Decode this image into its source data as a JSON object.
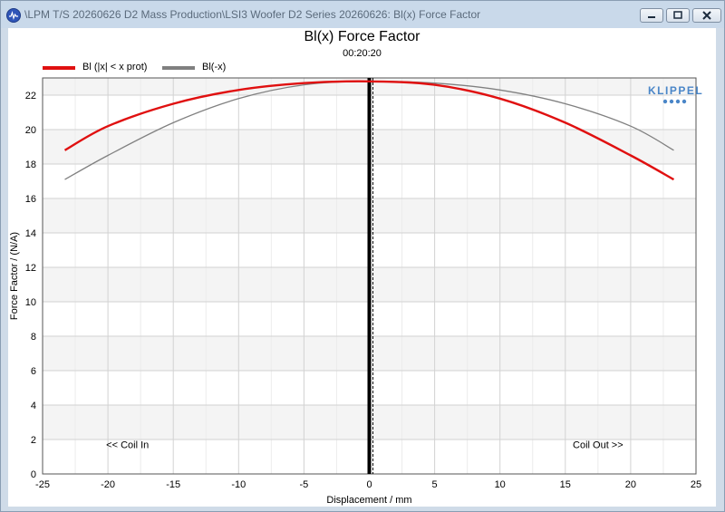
{
  "window": {
    "title": "\\LPM T/S 20260626 D2 Mass Production\\LSI3 Woofer D2 Series 20260626: Bl(x) Force Factor"
  },
  "colors": {
    "series_main": "#e01010",
    "series_secondary": "#808080",
    "zero_line": "#000000",
    "brand": "#4a86c8"
  },
  "brand": {
    "name": "KLIPPEL"
  },
  "chart_data": {
    "type": "line",
    "title": "Bl(x) Force Factor",
    "subtitle": "00:20:20",
    "xlabel": "Displacement / mm",
    "ylabel": "Force Factor / (N/A)",
    "xlim": [
      -25,
      25
    ],
    "ylim": [
      0,
      23
    ],
    "xticks": [
      -25,
      -20,
      -15,
      -10,
      -5,
      0,
      5,
      10,
      15,
      20,
      25
    ],
    "yticks": [
      0,
      2,
      4,
      6,
      8,
      10,
      12,
      14,
      16,
      18,
      20,
      22
    ],
    "grid": true,
    "legend_position": "top-left",
    "annotations": [
      {
        "text": "<< Coil In",
        "x": -18.5,
        "y": 1.7
      },
      {
        "text": "Coil Out >>",
        "x": 17.5,
        "y": 1.7
      }
    ],
    "vertical_marker_x": 0,
    "series": [
      {
        "name": "Bl (|x| < x prot)",
        "x": [
          -23.3,
          -20,
          -15,
          -10,
          -5,
          0,
          5,
          10,
          15,
          20,
          23.3
        ],
        "values": [
          18.8,
          20.2,
          21.5,
          22.3,
          22.7,
          22.8,
          22.6,
          21.8,
          20.4,
          18.5,
          17.1
        ]
      },
      {
        "name": "Bl(-x)",
        "x": [
          -23.3,
          -20,
          -15,
          -10,
          -5,
          0,
          5,
          10,
          15,
          20,
          23.3
        ],
        "values": [
          17.1,
          18.5,
          20.4,
          21.8,
          22.6,
          22.8,
          22.7,
          22.3,
          21.5,
          20.2,
          18.8
        ]
      }
    ]
  }
}
